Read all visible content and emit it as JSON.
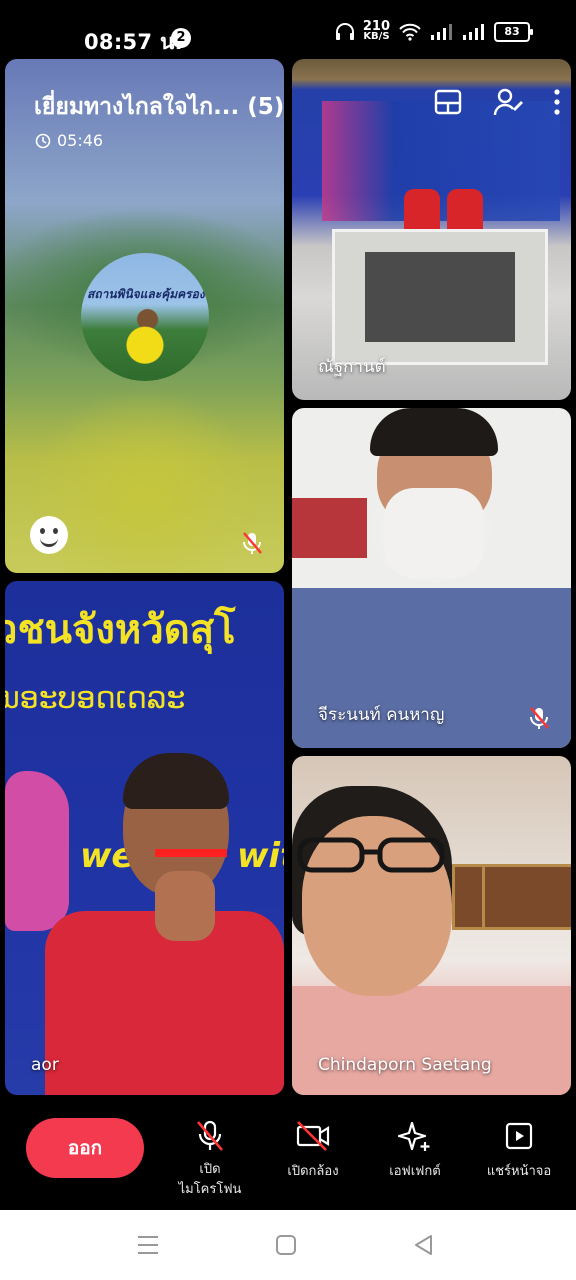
{
  "status_bar": {
    "time": "08:57 น.",
    "notification_count": "2",
    "net_speed_value": "210",
    "net_speed_unit": "KB/S",
    "battery": "83"
  },
  "meeting": {
    "title": "เยี่ยมทางไกลใจไก... (5)",
    "duration": "05:46"
  },
  "self_tile": {
    "avatar_text": "สถานพินิจและคุ้มครอง"
  },
  "participants": [
    {
      "name": "ณัฐกานต์"
    },
    {
      "name": "จีระนนท์ คนหาญ"
    },
    {
      "name": "aor"
    },
    {
      "name": "Chindaporn Saetang"
    }
  ],
  "backgrounds": {
    "boy_banner_line1": "วชนจังหวัดสุโ",
    "boy_banner_line2": "ນອະບອດເດລະ",
    "boy_banner_we": "we",
    "boy_banner_wit": "wit"
  },
  "controls": {
    "leave_label": "ออก",
    "mic_label": "เปิด\nไมโครโฟน",
    "camera_label": "เปิดกล้อง",
    "effects_label": "เอฟเฟกต์",
    "share_label": "แชร์หน้าจอ"
  },
  "colors": {
    "leave_button": "#f43a4e",
    "background": "#000000"
  }
}
